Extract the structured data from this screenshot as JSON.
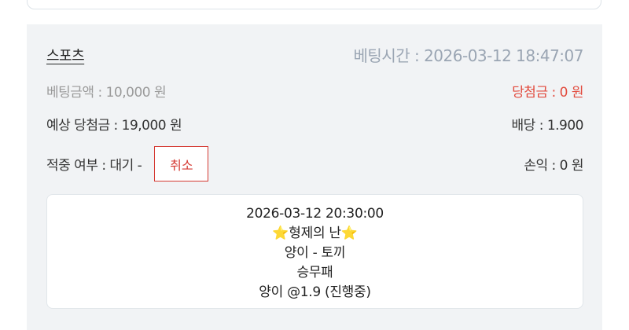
{
  "bet": {
    "category": "스포츠",
    "bet_time": "베팅시간 : 2026-03-12 18:47:07",
    "bet_amount": "베팅금액 : 10,000 원",
    "win_amount": "당첨금 : 0 원",
    "expected_win": "예상 당첨금 : 19,000 원",
    "odds": "배당 : 1.900",
    "hit_status": "적중 여부 : 대기 -",
    "cancel_label": "취소",
    "profit_loss": "손익 : 0 원",
    "detail": {
      "match_time": "2026-03-12 20:30:00",
      "star": "⭐",
      "league": "형제의 난",
      "match_teams": "양이 - 토끼",
      "market": "승무패",
      "pick": "양이 @1.9 (진행중)"
    }
  },
  "colors": {
    "win_accent": "#e24a3d",
    "cancel_border": "#d53a33",
    "muted_text": "#9aa5b3",
    "card_background": "#f1f3f5"
  }
}
